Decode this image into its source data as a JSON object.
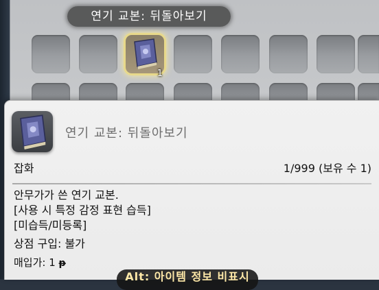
{
  "grid": {
    "hover_tooltip": "연기 교본: 뒤돌아보기",
    "selected_slot": {
      "icon": "book-icon",
      "stack_count": "1"
    }
  },
  "item": {
    "icon": "book-icon",
    "name": "연기 교본: 뒤돌아보기",
    "category": "잡화",
    "count": "1/999 (보유 수 1)",
    "description": [
      "안무가가 쓴 연기 교본.",
      "[사용 시 특정 감정 표현 습득]",
      "[미습득/미등록]",
      "상점 구입: 불가"
    ],
    "sell_label": "매입가: 1",
    "sell_currency_icon": "gil-icon",
    "sell_currency_symbol": "ᵽ"
  },
  "hint": {
    "text": "Alt: 아이템 정보 비표시"
  },
  "colors": {
    "panel_bg": "#c9cbcd",
    "detail_bg": "#ededed",
    "highlight": "#e8d98a",
    "hint_text": "#ffe9a8"
  }
}
